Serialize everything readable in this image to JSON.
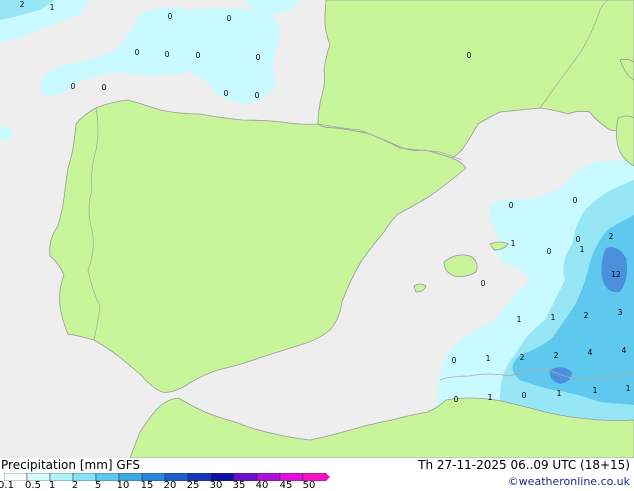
{
  "product": "Precipitation [mm]",
  "model": "GFS",
  "valid_time": "Th 27-11-2025 06..09 UTC (18+15)",
  "credit": "©weatheronline.co.uk",
  "colors": {
    "sea": "#eeeeee",
    "land": "#c8f59a",
    "coast": "#9a9a9a",
    "border": "#aaaaaa",
    "precip_light": "#c8faff",
    "precip_mid": "#96e6f6",
    "precip_strong": "#5fc8ee",
    "precip_heavy": "#4a90dc"
  },
  "legend": {
    "ticks": [
      "0.1",
      "0.5",
      "1",
      "2",
      "5",
      "10",
      "15",
      "20",
      "25",
      "30",
      "35",
      "40",
      "45",
      "50"
    ],
    "colors": [
      "#f5fffe",
      "#d4fbff",
      "#aff2fb",
      "#86e2f5",
      "#5dc8ef",
      "#3aa9e6",
      "#2a86d8",
      "#1c5fc8",
      "#1236b6",
      "#0d12a0",
      "#6a12c8",
      "#a812d4",
      "#de10da",
      "#f412c4"
    ]
  },
  "map_labels": [
    {
      "text": "2"
    },
    {
      "text": "1"
    },
    {
      "text": "0"
    },
    {
      "text": "0"
    },
    {
      "text": "0"
    },
    {
      "text": "0"
    },
    {
      "text": "0"
    },
    {
      "text": "0"
    },
    {
      "text": "0"
    },
    {
      "text": "0"
    },
    {
      "text": "0"
    },
    {
      "text": "0"
    },
    {
      "text": "0"
    },
    {
      "text": "0"
    },
    {
      "text": "0"
    },
    {
      "text": "1"
    },
    {
      "text": "0"
    },
    {
      "text": "2"
    },
    {
      "text": "12"
    },
    {
      "text": "0"
    },
    {
      "text": "1"
    },
    {
      "text": "0"
    },
    {
      "text": "1"
    },
    {
      "text": "1"
    },
    {
      "text": "2"
    },
    {
      "text": "3"
    },
    {
      "text": "0"
    },
    {
      "text": "1"
    },
    {
      "text": "2"
    },
    {
      "text": "2"
    },
    {
      "text": "4"
    },
    {
      "text": "4"
    },
    {
      "text": "0"
    },
    {
      "text": "1"
    },
    {
      "text": "0"
    },
    {
      "text": "1"
    },
    {
      "text": "1"
    },
    {
      "text": "1"
    }
  ]
}
